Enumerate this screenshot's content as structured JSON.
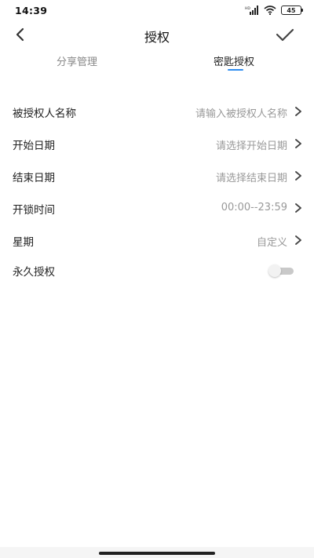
{
  "status_bar": {
    "time": "14:39",
    "battery": "45",
    "signal_icon": "signal-icon",
    "wifi_icon": "wifi-icon"
  },
  "nav": {
    "title": "授权",
    "back_icon": "chevron-left-icon",
    "confirm_icon": "checkmark-icon"
  },
  "tabs": [
    {
      "label": "分享管理",
      "active": false
    },
    {
      "label": "密匙授权",
      "active": true
    }
  ],
  "accent_color": "#2d8cf0",
  "form": {
    "rows": [
      {
        "label": "被授权人名称",
        "value": "请输入被授权人名称"
      },
      {
        "label": "开始日期",
        "value": "请选择开始日期"
      },
      {
        "label": "结束日期",
        "value": "请选择结束日期"
      },
      {
        "label": "开锁时间",
        "value": "00:00--23:59"
      },
      {
        "label": "星期",
        "value": "自定义"
      }
    ],
    "permanent": {
      "label": "永久授权",
      "enabled": false
    }
  }
}
